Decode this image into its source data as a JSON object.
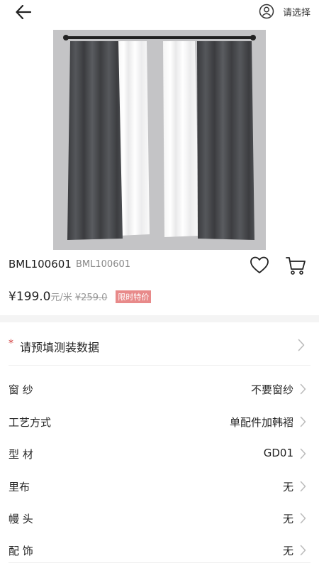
{
  "header": {
    "select_label": "请选择"
  },
  "product": {
    "sku": "BML100601",
    "sku_secondary": "BML100601",
    "price": "¥199.0",
    "unit": "元/米",
    "old_price": "¥259.0",
    "promo_badge": "限时特价"
  },
  "measurement": {
    "required_mark": "*",
    "label": "请预填测装数据"
  },
  "options": [
    {
      "label": "窗 纱",
      "value": "不要窗纱"
    },
    {
      "label": "工艺方式",
      "value": "单配件加韩褶"
    },
    {
      "label": "型 材",
      "value": "GD01"
    },
    {
      "label": "里布",
      "value": "无"
    },
    {
      "label": "幔 头",
      "value": "无"
    },
    {
      "label": "配 饰",
      "value": "无"
    }
  ],
  "colors": {
    "accent_red": "#d03a3a",
    "promo_bg": "#e88a8a",
    "image_bg": "#c4c4c6"
  }
}
